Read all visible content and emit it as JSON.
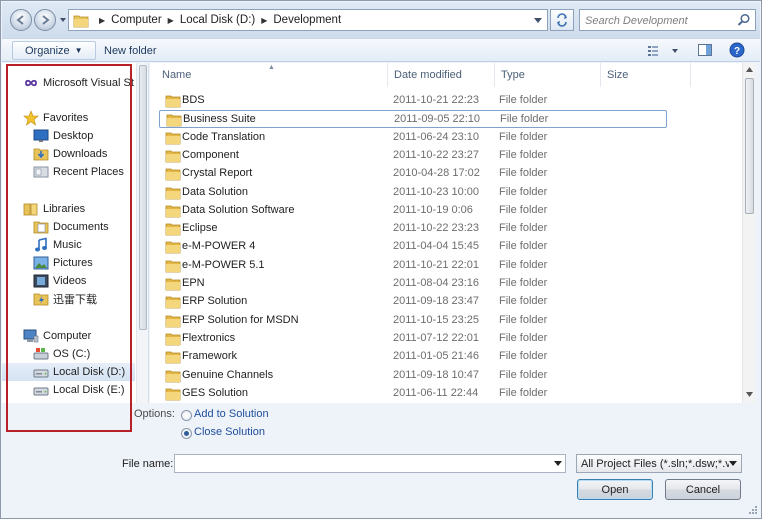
{
  "address_bar": {
    "crumbs": [
      "Computer",
      "Local Disk (D:)",
      "Development"
    ],
    "search_placeholder": "Search Development"
  },
  "toolbar": {
    "organize_label": "Organize",
    "new_folder_label": "New folder"
  },
  "nav_pane": {
    "items": [
      {
        "label": "Microsoft Visual St",
        "icon": "infinity-icon",
        "kind": "group"
      },
      {
        "label": "Favorites",
        "icon": "star-icon",
        "kind": "group"
      },
      {
        "label": "Desktop",
        "icon": "desktop-icon",
        "kind": "sub"
      },
      {
        "label": "Downloads",
        "icon": "downloads-icon",
        "kind": "sub"
      },
      {
        "label": "Recent Places",
        "icon": "recent-places-icon",
        "kind": "sub"
      },
      {
        "label": "Libraries",
        "icon": "libraries-icon",
        "kind": "group"
      },
      {
        "label": "Documents",
        "icon": "documents-icon",
        "kind": "sub"
      },
      {
        "label": "Music",
        "icon": "music-icon",
        "kind": "sub"
      },
      {
        "label": "Pictures",
        "icon": "pictures-icon",
        "kind": "sub"
      },
      {
        "label": "Videos",
        "icon": "videos-icon",
        "kind": "sub"
      },
      {
        "label": "迅雷下载",
        "icon": "thunder-download-icon",
        "kind": "sub"
      },
      {
        "label": "Computer",
        "icon": "computer-icon",
        "kind": "group"
      },
      {
        "label": "OS (C:)",
        "icon": "os-drive-icon",
        "kind": "sub"
      },
      {
        "label": "Local Disk (D:)",
        "icon": "drive-icon",
        "kind": "sub",
        "selected": true
      },
      {
        "label": "Local Disk (E:)",
        "icon": "drive-icon",
        "kind": "sub"
      }
    ]
  },
  "file_list": {
    "columns": [
      "Name",
      "Date modified",
      "Type",
      "Size"
    ],
    "rows": [
      {
        "name": "BDS",
        "date": "2011-10-21 22:23",
        "type": "File folder"
      },
      {
        "name": "Business Suite",
        "date": "2011-09-05 22:10",
        "type": "File folder",
        "focused": true
      },
      {
        "name": "Code Translation",
        "date": "2011-06-24 23:10",
        "type": "File folder"
      },
      {
        "name": "Component",
        "date": "2011-10-22 23:27",
        "type": "File folder"
      },
      {
        "name": "Crystal Report",
        "date": "2010-04-28 17:02",
        "type": "File folder"
      },
      {
        "name": "Data Solution",
        "date": "2011-10-23 10:00",
        "type": "File folder"
      },
      {
        "name": "Data Solution Software",
        "date": "2011-10-19 0:06",
        "type": "File folder"
      },
      {
        "name": "Eclipse",
        "date": "2011-10-22 23:23",
        "type": "File folder"
      },
      {
        "name": "e-M-POWER 4",
        "date": "2011-04-04 15:45",
        "type": "File folder"
      },
      {
        "name": "e-M-POWER 5.1",
        "date": "2011-10-21 22:01",
        "type": "File folder"
      },
      {
        "name": "EPN",
        "date": "2011-08-04 23:16",
        "type": "File folder"
      },
      {
        "name": "ERP Solution",
        "date": "2011-09-18 23:47",
        "type": "File folder"
      },
      {
        "name": "ERP Solution for MSDN",
        "date": "2011-10-15 23:25",
        "type": "File folder"
      },
      {
        "name": "Flextronics",
        "date": "2011-07-12 22:01",
        "type": "File folder"
      },
      {
        "name": "Framework",
        "date": "2011-01-05 21:46",
        "type": "File folder"
      },
      {
        "name": "Genuine Channels",
        "date": "2011-09-18 10:47",
        "type": "File folder"
      },
      {
        "name": "GES Solution",
        "date": "2011-06-11 22:44",
        "type": "File folder"
      }
    ]
  },
  "options": {
    "label": "Options:",
    "choices": [
      {
        "label": "Add to Solution",
        "checked": false
      },
      {
        "label": "Close Solution",
        "checked": true
      }
    ]
  },
  "file_name": {
    "label": "File name:",
    "value": ""
  },
  "file_type_filter": "All Project Files (*.sln;*.dsw;*.vc",
  "buttons": {
    "open": "Open",
    "cancel": "Cancel"
  },
  "colors": {
    "accent_blue": "#1f4e9c",
    "highlight_red": "#b72026",
    "folder_yellow": "#e8c35a"
  }
}
